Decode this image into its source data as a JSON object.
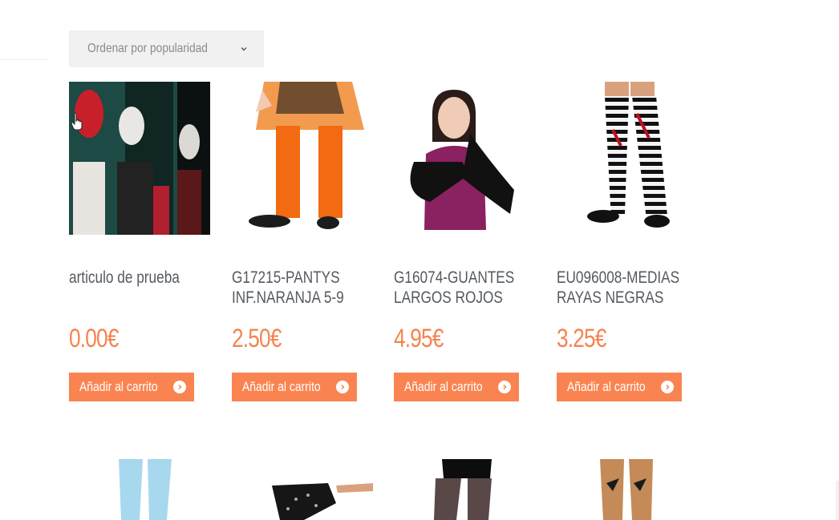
{
  "sort": {
    "label": "Ordenar por popularidad"
  },
  "products": [
    {
      "title": "articulo de prueba",
      "price": "0.00€",
      "button": "Añadir al carrito"
    },
    {
      "title": "G17215-PANTYS INF.NARANJA 5-9",
      "price": "2.50€",
      "button": "Añadir al carrito"
    },
    {
      "title": "G16074-GUANTES LARGOS ROJOS",
      "price": "4.95€",
      "button": "Añadir al carrito"
    },
    {
      "title": "EU096008-MEDIAS RAYAS NEGRAS",
      "price": "3.25€",
      "button": "Añadir al carrito"
    }
  ],
  "colors": {
    "accent": "#fa8451",
    "price": "#f5834f",
    "text": "#555a60"
  }
}
